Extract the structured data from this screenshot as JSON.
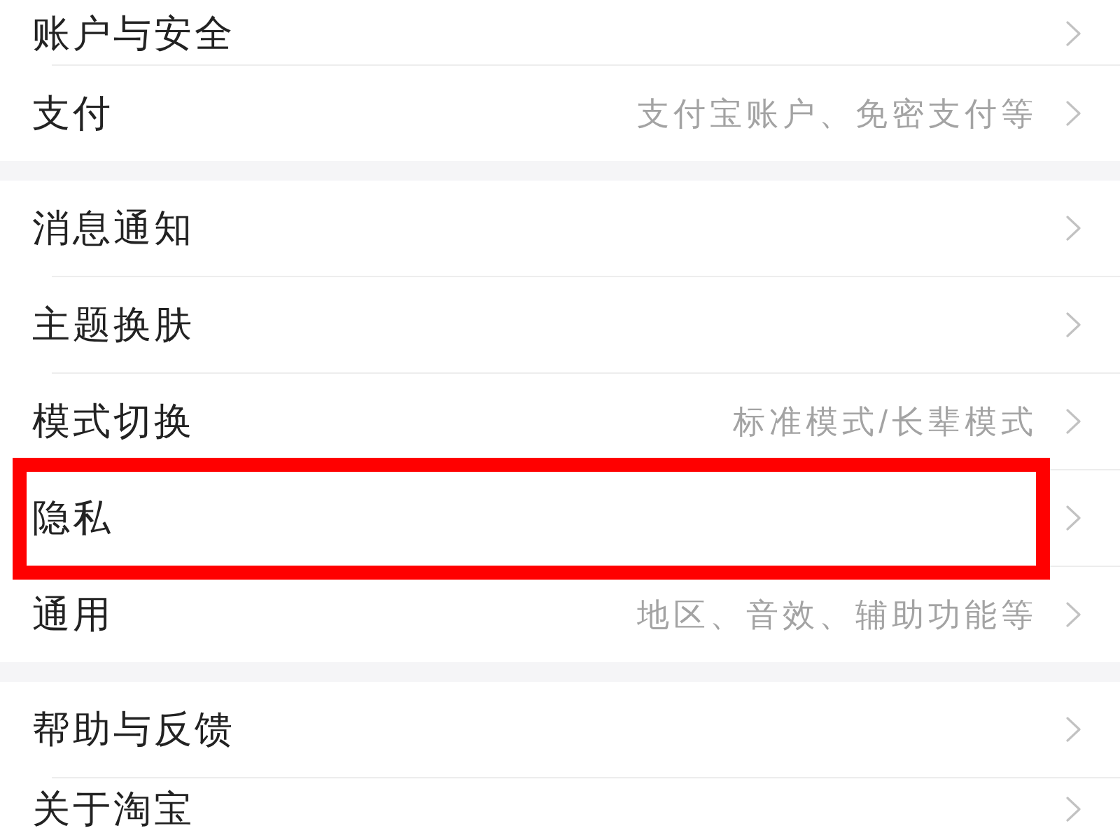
{
  "groups": [
    {
      "items": [
        {
          "label": "账户与安全",
          "highlighted": false
        },
        {
          "label": "支付",
          "detail": "支付宝账户、免密支付等",
          "highlighted": false
        }
      ]
    },
    {
      "items": [
        {
          "label": "消息通知",
          "highlighted": false
        },
        {
          "label": "主题换肤",
          "highlighted": false
        },
        {
          "label": "模式切换",
          "detail": "标准模式/长辈模式",
          "highlighted": false
        },
        {
          "label": "隐私",
          "highlighted": true
        },
        {
          "label": "通用",
          "detail": "地区、音效、辅助功能等",
          "highlighted": false
        }
      ]
    },
    {
      "items": [
        {
          "label": "帮助与反馈",
          "highlighted": false
        },
        {
          "label": "关于淘宝",
          "highlighted": false
        }
      ]
    }
  ]
}
